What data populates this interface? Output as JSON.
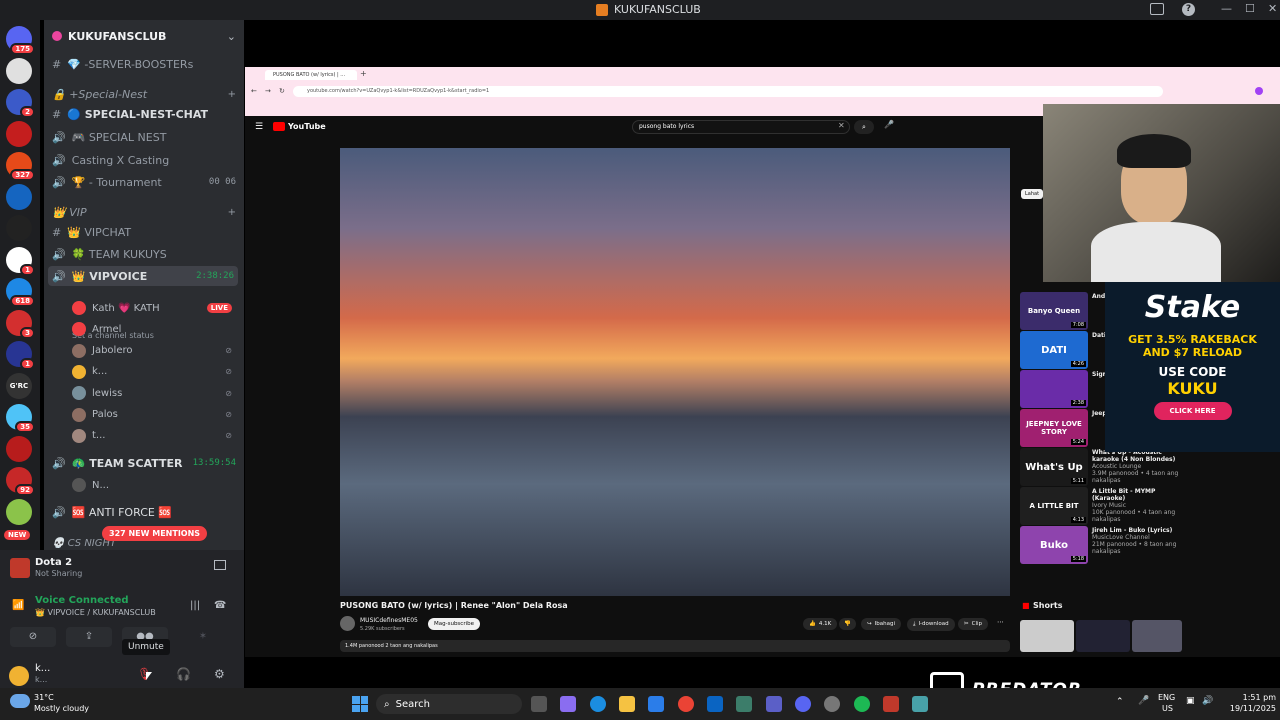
{
  "window": {
    "title": "KUKUFANSCLUB"
  },
  "servers": [
    {
      "badge": "175",
      "color": "#5865f2"
    },
    {
      "badge": "",
      "color": "#e0e0e0"
    },
    {
      "badge": "2",
      "color": "#3b5ac9"
    },
    {
      "badge": "",
      "color": "#c41e1e"
    },
    {
      "badge": "327",
      "color": "#e64a19"
    },
    {
      "badge": "",
      "color": "#1565c0"
    },
    {
      "badge": "",
      "color": "#222222"
    },
    {
      "badge": "1",
      "color": "#ffffff"
    },
    {
      "badge": "618",
      "color": "#1e88e5"
    },
    {
      "badge": "3",
      "color": "#d32f2f"
    },
    {
      "badge": "1",
      "color": "#283593"
    },
    {
      "badge": "",
      "color": "#333333",
      "text": "G'RC"
    },
    {
      "badge": "35",
      "color": "#4fc3f7"
    },
    {
      "badge": "",
      "color": "#b71c1c"
    },
    {
      "badge": "92",
      "color": "#c62828"
    },
    {
      "badge": "",
      "color": "#8bc34a"
    }
  ],
  "new_label": "NEW",
  "guild": {
    "name": "KUKUFANSCLUB"
  },
  "channels": [
    {
      "name": "💎 -SERVER-BOOSTERs",
      "type": "text",
      "bold": false
    },
    {
      "name": "🔒 +Special-Nest",
      "type": "category"
    },
    {
      "name": "🔵 SPECIAL-NEST-CHAT",
      "type": "text",
      "bold": true
    },
    {
      "name": "🎮 SPECIAL NEST",
      "type": "voice",
      "bold": false
    },
    {
      "name": "Casting X Casting",
      "type": "voice",
      "bold": false
    },
    {
      "name": "🏆 - Tournament",
      "type": "voice",
      "bold": false,
      "extra": "00  06"
    },
    {
      "name": "👑 VIP",
      "type": "category"
    },
    {
      "name": "👑 VIPCHAT",
      "type": "text",
      "bold": false
    },
    {
      "name": "🍀 TEAM KUKUYS",
      "type": "voice",
      "bold": false
    },
    {
      "name": "👑 VIPVOICE",
      "type": "voice",
      "bold": true,
      "extra": "2:38:26"
    }
  ],
  "vip_status": "Set a channel status",
  "vip_users": [
    {
      "name": "Kath 💗 KATH",
      "live": "LIVE",
      "color": "#f23f43"
    },
    {
      "name": "Armel",
      "color": "#f23f43"
    },
    {
      "name": "Jabolero",
      "color": "#8d6e63"
    },
    {
      "name": "k...",
      "color": "#f0b232"
    },
    {
      "name": "lewiss",
      "color": "#78909c"
    },
    {
      "name": "Palos",
      "color": "#8d6e63"
    },
    {
      "name": "t...",
      "color": "#a1887f"
    }
  ],
  "team_scatter": {
    "name": "🦚 TEAM SCATTER",
    "time": "13:59:54"
  },
  "scatter_user": "N...",
  "anti_force": "🆘 ANTI FORCE 🆘",
  "cs_night": "💀 CS NIGHT",
  "new_mentions": "327 NEW MENTIONS",
  "activity": {
    "title": "Dota 2",
    "sub": "Not Sharing"
  },
  "voice": {
    "status": "Voice Connected",
    "channel": "👑 VIPVOICE / KUKUFANSCLUB"
  },
  "unmute_tip": "Unmute",
  "me": {
    "name": "k...",
    "sub": "k..."
  },
  "browser": {
    "tab": "PUSONG BATO (w/ lyrics) | ...",
    "url": "youtube.com/watch?v=UZaQvyp1-k&list=RDUZaQvyp1-k&start_radio=1"
  },
  "youtube": {
    "logo": "YouTube",
    "search": "pusong bato lyrics",
    "video_title": "PUSONG BATO (w/ lyrics) | Renee \"Alon\" Dela Rosa",
    "channel": "MUSICdefinesME05",
    "subs": "5.29K subscribers",
    "subscribe": "Mag-subscribe",
    "likes": "4.1K",
    "share": "Ibahagi",
    "download": "I-download",
    "clip": "Clip",
    "views": "1.4M panonood  2 taon ang nakalipas",
    "chip": "Lahat",
    "shorts": "Shorts"
  },
  "recs": [
    {
      "thumb": "Banyo Queen",
      "color": "#3b2c6b",
      "title": "Andr... (Lyric...",
      "dur": "7:08"
    },
    {
      "thumb": "DATI",
      "color": "#1e6ad1",
      "title": "Dati -... Dos S...",
      "dur": "4:26"
    },
    {
      "thumb": "",
      "color": "#6a2ca8",
      "title": "Sigm...",
      "dur": "2:38"
    },
    {
      "thumb": "JEEPNEY LOVE STORY",
      "color": "#a02070",
      "title": "Jeep... Cons...",
      "dur": "5:24"
    },
    {
      "thumb": "What's Up",
      "color": "#1a1a1a",
      "title": "What's Up - Acoustic karaoke (4 Non Blondes)",
      "ch": "Acoustic Lounge",
      "meta": "3.9M panonood • 4 taon ang nakalipas",
      "dur": "5:11"
    },
    {
      "thumb": "A LITTLE BIT",
      "color": "#1f1f1f",
      "title": "A Little Bit - MYMP (Karaoke)",
      "ch": "Ivory Music",
      "meta": "10K panonood • 4 taon ang nakalipas",
      "dur": "4:13"
    },
    {
      "thumb": "Buko",
      "color": "#8e44ad",
      "title": "Jireh Lim - Buko (Lyrics)",
      "ch": "MusicLove Channel",
      "meta": "21M panonood • 8 taon ang nakalipas",
      "dur": "5:18"
    }
  ],
  "stake": {
    "logo": "Stake",
    "l1": "GET 3.5% RAKEBACK",
    "l2": "AND $7 RELOAD",
    "l3": "USE CODE",
    "code": "KUKU",
    "btn": "CLICK HERE"
  },
  "predator": "PREDATOR",
  "weather": {
    "temp": "31°C",
    "desc": "Mostly cloudy"
  },
  "taskbar": {
    "search": "Search",
    "lang1": "ENG",
    "lang2": "US",
    "time": "1:51 pm",
    "date": "19/11/2025"
  }
}
